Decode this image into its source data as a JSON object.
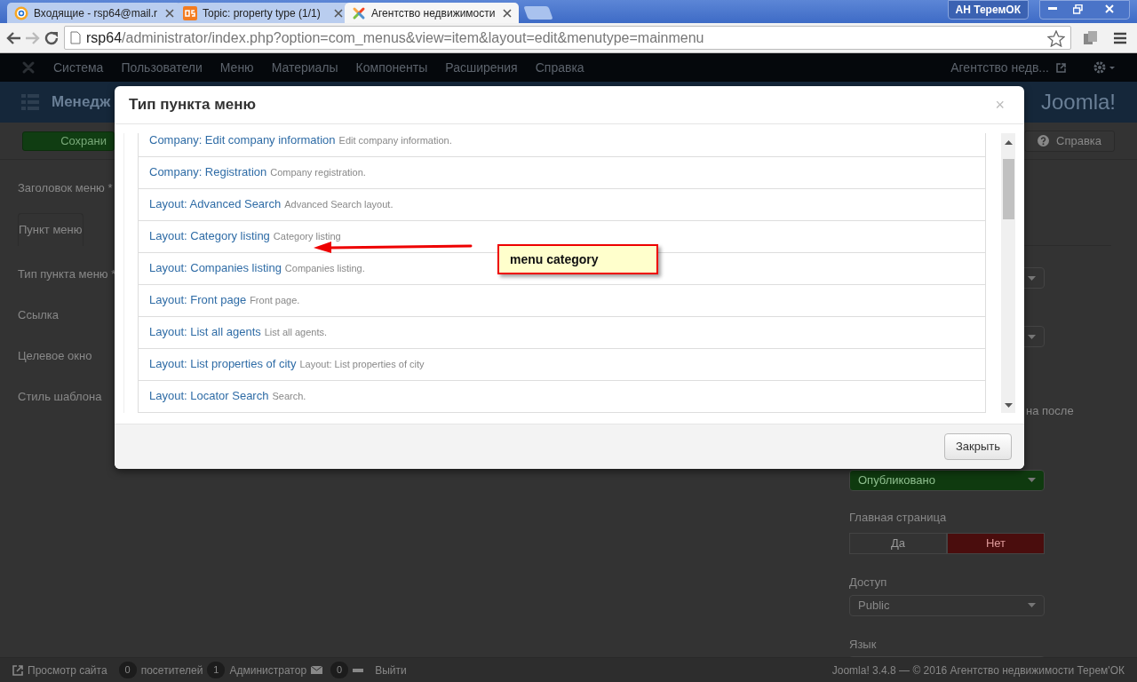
{
  "browser": {
    "tabs": [
      {
        "title": "Входящие - rsp64@mail.r",
        "selected": false
      },
      {
        "title": "Topic: property type (1/1)",
        "selected": false
      },
      {
        "title": "Агентство недвижимости",
        "selected": true
      }
    ],
    "profile": "АН ТеремОК",
    "url": "rsp64/administrator/index.php?option=com_menus&view=item&layout=edit&menutype=mainmenu"
  },
  "admin_nav": {
    "items": [
      "Система",
      "Пользователи",
      "Меню",
      "Материалы",
      "Компоненты",
      "Расширения",
      "Справка"
    ],
    "site_link": "Агентство недв..."
  },
  "header": {
    "title": "Менедж",
    "logo": "Joomla!"
  },
  "toolbar": {
    "save": "Сохрани",
    "help": "Справка"
  },
  "form_left": {
    "title_label": "Заголовок меню *",
    "tab": "Пункт меню",
    "labels": [
      "Тип пункта меню *",
      "Ссылка",
      "Целевое окно",
      "Стиль шаблона"
    ]
  },
  "form_right": {
    "cut_text": "на после",
    "status": "Опубликовано",
    "home_label": "Главная страница",
    "home_toggle": [
      {
        "label": "Да",
        "selected": false
      },
      {
        "label": "Нет",
        "selected": true
      }
    ],
    "access_label": "Доступ",
    "access": "Public",
    "language_label": "Язык"
  },
  "modal": {
    "title": "Тип пункта меню",
    "close": "×",
    "items": [
      {
        "title": "Company: Edit company information",
        "description": "Edit company information."
      },
      {
        "title": "Company: Registration",
        "description": "Company registration."
      },
      {
        "title": "Layout: Advanced Search",
        "description": "Advanced Search layout."
      },
      {
        "title": "Layout: Category listing",
        "description": "Category listing"
      },
      {
        "title": "Layout: Companies listing",
        "description": "Companies listing."
      },
      {
        "title": "Layout: Front page",
        "description": "Front page."
      },
      {
        "title": "Layout: List all agents",
        "description": "List all agents."
      },
      {
        "title": "Layout: List properties of city",
        "description": "Layout: List properties of city"
      },
      {
        "title": "Layout: Locator Search",
        "description": "Search."
      }
    ],
    "button": "Закрыть"
  },
  "annotation": {
    "text": "menu category"
  },
  "footer": {
    "view_site": "Просмотр сайта",
    "visitors_count": "0",
    "visitors": "посетителей",
    "admins_count": "1",
    "admins": "Администратор",
    "messages_count": "0",
    "logout": "Выйти",
    "copyright": "Joomla! 3.4.8  —  © 2016 Агентство недвижимости Терем'ОК"
  }
}
